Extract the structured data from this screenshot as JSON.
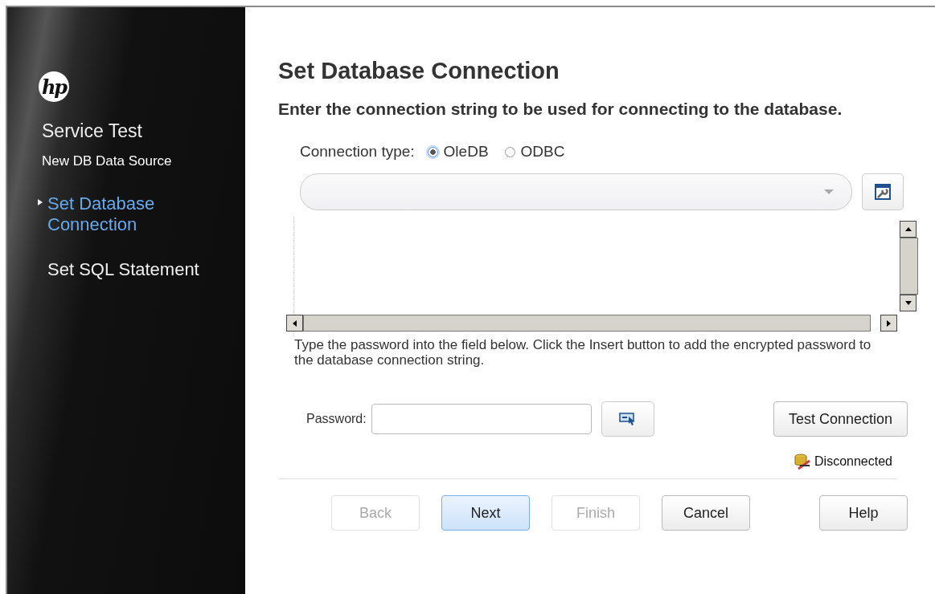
{
  "sidebar": {
    "logo": "hp",
    "product": "Service Test",
    "wizard": "New DB Data Source",
    "steps": [
      {
        "label": "Set Database Connection",
        "selected": true
      },
      {
        "label": "Set SQL Statement",
        "selected": false
      }
    ]
  },
  "page": {
    "title": "Set Database Connection",
    "subtitle": "Enter the connection string to be used for connecting to the database.",
    "connection_type": {
      "label": "Connection type:",
      "options": [
        {
          "label": "OleDB",
          "selected": true
        },
        {
          "label": "ODBC",
          "selected": false
        }
      ]
    },
    "hint": "Type the password into the field below. Click the Insert button to add the encrypted password to the database connection string.",
    "password": {
      "label": "Password:"
    },
    "test_button": "Test Connection",
    "status": "Disconnected"
  },
  "buttons": [
    {
      "label": "Back",
      "disabled": true,
      "default": false
    },
    {
      "label": "Next",
      "disabled": false,
      "default": true
    },
    {
      "label": "Finish",
      "disabled": true,
      "default": false
    },
    {
      "label": "Cancel",
      "disabled": false,
      "default": false
    },
    {
      "label": "Help",
      "disabled": false,
      "default": false
    }
  ]
}
